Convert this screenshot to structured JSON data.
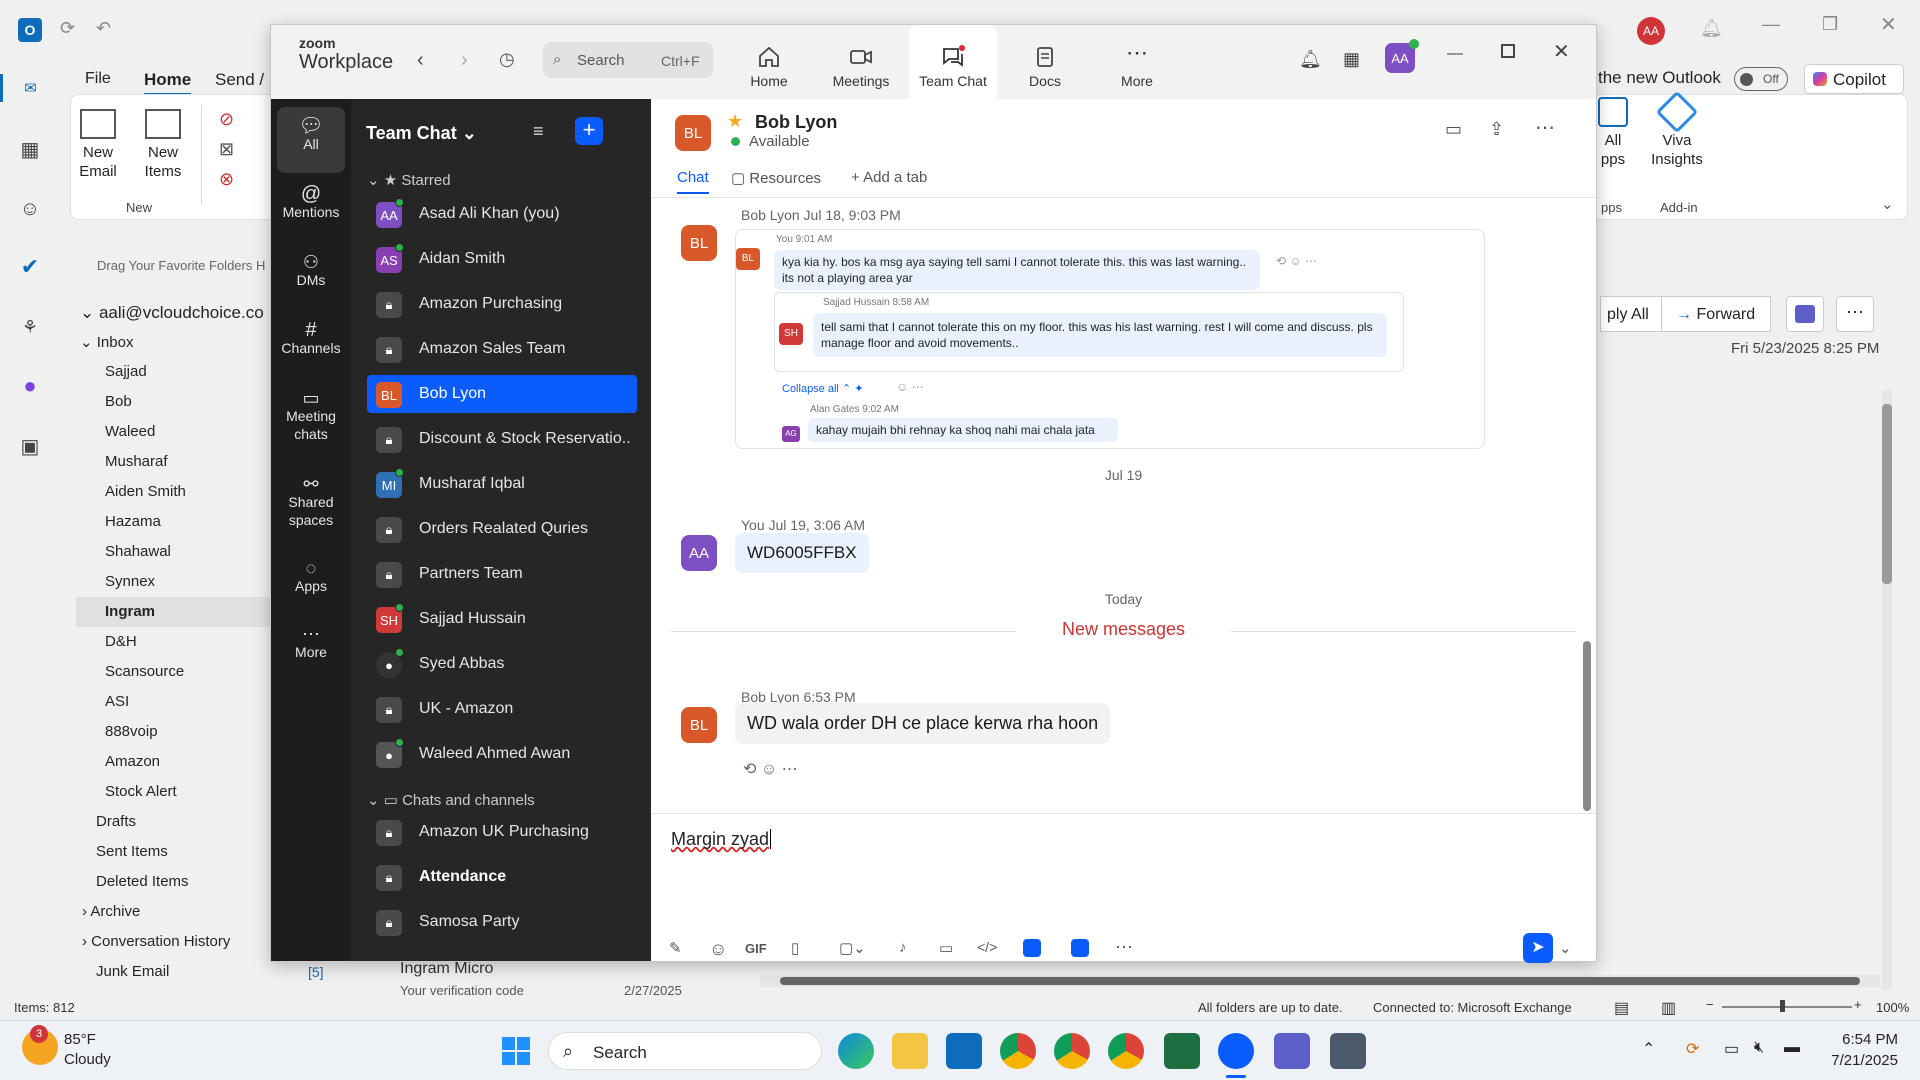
{
  "outlook": {
    "menu": {
      "file": "File",
      "home": "Home",
      "send": "Send /"
    },
    "ribbon": {
      "new_email": "New Email",
      "new_items": "New Items",
      "new_group": "New",
      "all_apps_a": "All",
      "all_apps_b": "pps",
      "apps_group": "pps",
      "viva": "Viva Insights",
      "addin_group": "Add-in"
    },
    "new_outlook": "the new Outlook",
    "toggle_state": "Off",
    "copilot": "Copilot",
    "reply_all": "ply All",
    "forward": "Forward",
    "mail_date": "Fri 5/23/2025 8:25 PM",
    "drag_hint": "Drag Your Favorite Folders H",
    "account": "aali@vcloudchoice.co",
    "inbox": "Inbox",
    "folders": [
      "Sajjad",
      "Bob",
      "Waleed",
      "Musharaf",
      "Aiden Smith",
      "Hazama",
      "Shahawal",
      "Synnex",
      "Ingram",
      "D&H",
      "Scansource",
      "ASI",
      "888voip",
      "Amazon",
      "Stock Alert"
    ],
    "top_folders": [
      "Drafts",
      "Sent Items",
      "Deleted Items",
      "Archive",
      "Conversation History",
      "Junk Email"
    ],
    "junk_count": "[5]",
    "preview_sender": "Ingram Micro",
    "preview_subject": "Your verification code",
    "preview_date": "2/27/2025",
    "status": {
      "items": "Items: 812",
      "sync": "All folders are up to date.",
      "connected": "Connected to: Microsoft Exchange",
      "zoom": "100%"
    },
    "avatar": "AA"
  },
  "zoom": {
    "logo_top": "zoom",
    "logo_bottom": "Workplace",
    "search_label": "Search",
    "search_shortcut": "Ctrl+F",
    "tabs": [
      {
        "label": "Home"
      },
      {
        "label": "Meetings"
      },
      {
        "label": "Team Chat"
      },
      {
        "label": "Docs"
      },
      {
        "label": "More"
      }
    ],
    "user_avatar": "AA",
    "rail": [
      {
        "label": "All"
      },
      {
        "label": "Mentions"
      },
      {
        "label": "DMs"
      },
      {
        "label": "Channels"
      },
      {
        "label": "Meeting chats"
      },
      {
        "label": "Shared spaces"
      },
      {
        "label": "Apps"
      },
      {
        "label": "More"
      }
    ],
    "list_title": "Team Chat",
    "starred_label": "Starred",
    "starred": [
      {
        "name": "Asad Ali Khan (you)",
        "initials": "AA",
        "color": "#7e4fc2"
      },
      {
        "name": "Aidan Smith",
        "initials": "AS",
        "color": "#8a3fb0"
      },
      {
        "name": "Amazon Purchasing",
        "initials": "",
        "color": ""
      },
      {
        "name": "Amazon Sales Team",
        "initials": "",
        "color": ""
      },
      {
        "name": "Bob Lyon",
        "initials": "BL",
        "color": "#d9582a"
      },
      {
        "name": "Discount & Stock Reservatio...",
        "initials": "",
        "color": ""
      },
      {
        "name": "Musharaf Iqbal",
        "initials": "MI",
        "color": "#2f6fb3"
      },
      {
        "name": "Orders Realated Quries",
        "initials": "",
        "color": ""
      },
      {
        "name": "Partners Team",
        "initials": "",
        "color": ""
      },
      {
        "name": "Sajjad Hussain",
        "initials": "SH",
        "color": "#d23a3a"
      },
      {
        "name": "Syed Abbas",
        "initials": "",
        "color": "#333"
      },
      {
        "name": "UK - Amazon",
        "initials": "",
        "color": ""
      },
      {
        "name": "Waleed Ahmed Awan",
        "initials": "",
        "color": "#555"
      }
    ],
    "chats_label": "Chats and channels",
    "chats": [
      {
        "name": "Amazon UK Purchasing"
      },
      {
        "name": "Attendance"
      },
      {
        "name": "Samosa Party"
      }
    ],
    "header": {
      "name": "Bob Lyon",
      "initials": "BL",
      "status": "Available"
    },
    "chat_tabs": {
      "chat": "Chat",
      "resources": "Resources",
      "add": "Add a tab"
    },
    "messages": {
      "m1_meta": "Bob Lyon Jul 18, 9:03 PM",
      "q_you": "You 9:01 AM",
      "q_you_text": "kya kia hy. bos ka msg aya saying tell sami I cannot tolerate this. this was last warning.. its not a playing area yar",
      "q_sh": "Sajjad Hussain  8:58 AM",
      "q_sh_text": "tell sami that I cannot tolerate this on my floor. this was his last warning. rest I will come and discuss. pls manage floor and avoid movements..",
      "collapse": "Collapse all",
      "q_ag": "Alan Gates 9:02 AM",
      "q_ag_text": "kahay mujaih bhi rehnay ka shoq nahi mai chala jata",
      "date1": "Jul 19",
      "m2_meta": "You Jul 19, 3:06 AM",
      "m2_text": "WD6005FFBX",
      "date2": "Today",
      "new_messages": "New messages",
      "m3_meta": "Bob Lyon 6:53 PM",
      "m3_text": "WD wala order DH ce place kerwa rha hoon"
    },
    "compose_text": "Margin zyad",
    "toolbar": {
      "gif": "GIF"
    }
  },
  "taskbar": {
    "weather_temp": "85°F",
    "weather_desc": "Cloudy",
    "weather_badge": "3",
    "search": "Search",
    "time": "6:54 PM",
    "date": "7/21/2025"
  },
  "colors": {
    "zoom_blue": "#0b5cff",
    "bubble": "#e8f1fd",
    "new_msg": "#c33",
    "outlook_blue": "#0f6cbd"
  }
}
